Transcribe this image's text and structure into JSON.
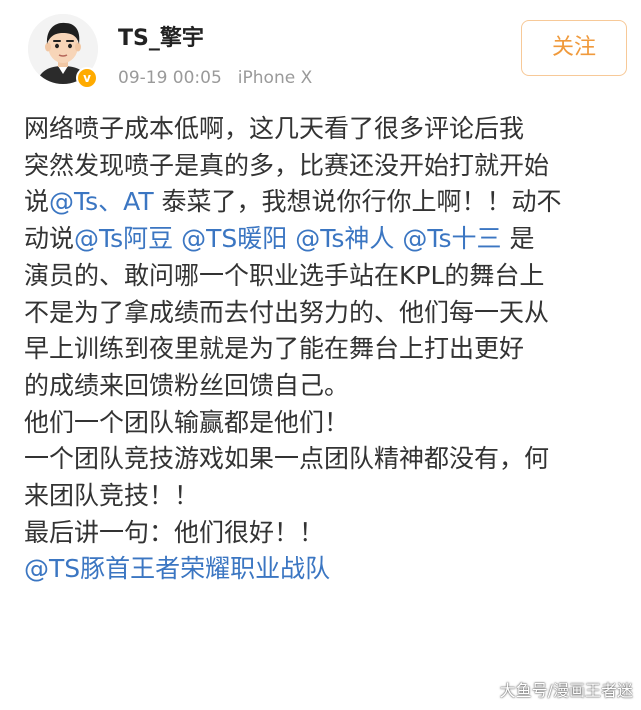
{
  "post": {
    "author": "TS_擎宇",
    "time": "09-19 00:05",
    "device": "iPhone X",
    "follow_label": "关注",
    "verified_badge": "v",
    "lines": [
      [
        {
          "t": "网络喷子成本低啊，这几天看了很多评论后我"
        }
      ],
      [
        {
          "t": "突然发现喷子是真的多，比赛还没开始打就开始"
        }
      ],
      [
        {
          "t": "说"
        },
        {
          "t": "@Ts、AT",
          "m": true
        },
        {
          "t": " 泰菜了，我想说你行你上啊！！动不"
        }
      ],
      [
        {
          "t": "动说"
        },
        {
          "t": "@Ts阿豆",
          "m": true
        },
        {
          "t": " "
        },
        {
          "t": "@TS暖阳",
          "m": true
        },
        {
          "t": " "
        },
        {
          "t": "@Ts神人",
          "m": true
        },
        {
          "t": " "
        },
        {
          "t": "@Ts十三",
          "m": true
        },
        {
          "t": " 是"
        }
      ],
      [
        {
          "t": "演员的、敢问哪一个职业选手站在KPL的舞台上"
        }
      ],
      [
        {
          "t": "不是为了拿成绩而去付出努力的、他们每一天从"
        }
      ],
      [
        {
          "t": "早上训练到夜里就是为了能在舞台上打出更好"
        }
      ],
      [
        {
          "t": "的成绩来回馈粉丝回馈自己。"
        }
      ],
      [
        {
          "t": "他们一个团队输赢都是他们！"
        }
      ],
      [
        {
          "t": "一个团队竞技游戏如果一点团队精神都没有，何"
        }
      ],
      [
        {
          "t": "来团队竞技！！"
        }
      ],
      [
        {
          "t": "最后讲一句：他们很好！！"
        }
      ],
      [
        {
          "t": "@TS豚首王者荣耀职业战队",
          "m": true
        }
      ]
    ]
  },
  "watermark": "大鱼号/漫画王者迷",
  "colors": {
    "mention": "#3b76c2",
    "follow_text": "#f09a3c",
    "follow_border": "#f7c998",
    "verified": "#ffab00",
    "meta": "#9a9a9a"
  },
  "icons": {
    "avatar": "cartoon-avatar-icon",
    "verified": "verified-badge-icon"
  }
}
